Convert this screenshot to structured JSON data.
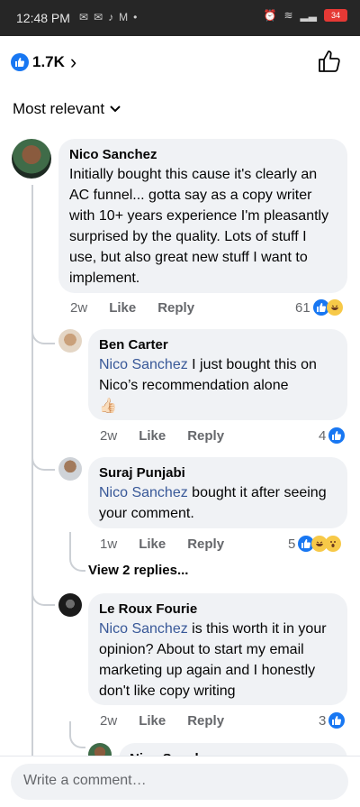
{
  "status_bar": {
    "time": "12:48 PM",
    "battery": "34"
  },
  "header": {
    "like_count": "1.7K"
  },
  "sort": {
    "label": "Most relevant"
  },
  "comments": [
    {
      "author": "Nico Sanchez",
      "text": "Initially bought this cause it's clearly an AC funnel... gotta say as a copy writer with 10+ years experience I'm pleasantly surprised by the quality. Lots of stuff I use, but also great new stuff I want to implement.",
      "time": "2w",
      "like": "Like",
      "reply": "Reply",
      "reaction_count": "61",
      "reactions": [
        "like-icon",
        "haha-icon"
      ]
    }
  ],
  "replies": [
    {
      "author": "Ben Carter",
      "mention": "Nico Sanchez",
      "text": " I just bought this on Nico’s recommendation alone",
      "emoji": "👍🏻",
      "time": "2w",
      "like": "Like",
      "reply": "Reply",
      "reaction_count": "4",
      "reactions": [
        "like-icon"
      ]
    },
    {
      "author": "Suraj Punjabi",
      "mention": "Nico Sanchez",
      "text": " bought it after seeing your comment.",
      "time": "1w",
      "like": "Like",
      "reply": "Reply",
      "reaction_count": "5",
      "reactions": [
        "like-icon",
        "haha-icon",
        "wow-icon"
      ]
    },
    {
      "author": "Le Roux Fourie",
      "mention": "Nico Sanchez",
      "text": " is this worth it in your opinion? About to start my email marketing up again and I honestly don't like copy writing",
      "time": "2w",
      "like": "Like",
      "reply": "Reply",
      "reaction_count": "3",
      "reactions": [
        "like-icon"
      ]
    },
    {
      "author": "Nico Sanchez"
    }
  ],
  "view_replies": "View 2 replies...",
  "composer": {
    "placeholder": "Write a comment…"
  },
  "colors": {
    "accent": "#1877f2",
    "mention": "#385898",
    "bubble": "#f0f2f5"
  }
}
